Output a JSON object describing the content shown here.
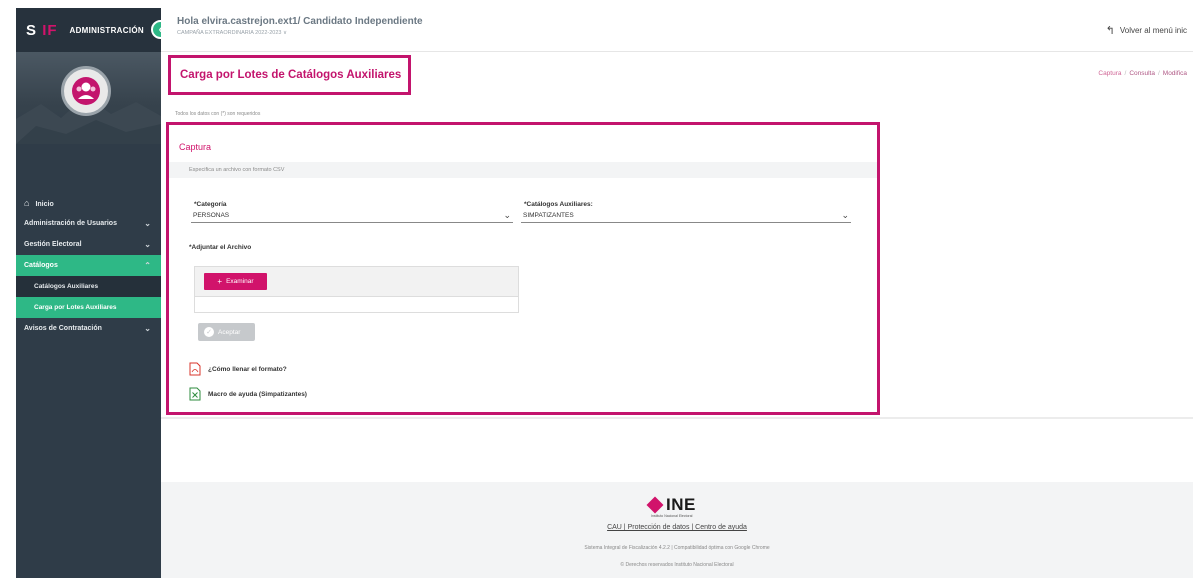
{
  "sidebar": {
    "logo": "S",
    "logo_accent": "IF",
    "title": "ADMINISTRACIÓN",
    "items": [
      {
        "label": "Inicio"
      },
      {
        "label": "Administración de Usuarios"
      },
      {
        "label": "Gestión Electoral"
      },
      {
        "label": "Catálogos"
      },
      {
        "label": "Catálogos Auxiliares"
      },
      {
        "label": "Carga por Lotes Auxiliares"
      },
      {
        "label": "Avisos de Contratación"
      }
    ]
  },
  "header": {
    "greeting": "Hola elvira.castrejon.ext1/ Candidato Independiente",
    "campaign": "CAMPAÑA EXTRAORDINARIA 2022-2023 ∨",
    "back_label": "Volver al menú inic"
  },
  "page": {
    "title": "Carga por Lotes de Catálogos Auxiliares",
    "breadcrumbs": [
      "Captura",
      "Consulta",
      "Modifica"
    ],
    "required_note": "Todos los datos con (*) son requeridos"
  },
  "panel": {
    "title": "Captura",
    "subtitle": "Especifica un archivo con formato CSV",
    "category_label": "*Categoría",
    "category_value": "PERSONAS",
    "catalog_label": "*Catálogos Auxiliares:",
    "catalog_value": "SIMPATIZANTES",
    "attach_label": "*Adjuntar el Archivo",
    "browse_label": "Examinar",
    "accept_label": "Aceptar",
    "link_pdf": "¿Cómo llenar el formato?",
    "link_xls": "Macro de ayuda (Simpatizantes)"
  },
  "footer": {
    "brand": "INE",
    "brand_sub": "Instituto Nacional Electoral",
    "links": "CAU | Protección de datos | Centro de ayuda",
    "line1": "Sistema Integral de Fiscalización 4.2.2 | Compatibilidad óptima con Google Chrome",
    "line2": "© Derechos reservados Instituto Nacional Electoral"
  },
  "colors": {
    "accent": "#c3146d",
    "sidebar_bg": "#2f3c48",
    "active_green": "#2eb886"
  }
}
